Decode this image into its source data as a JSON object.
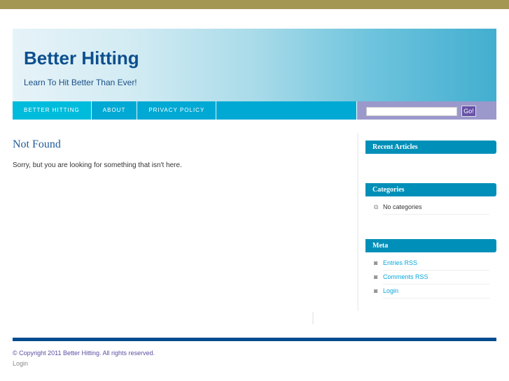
{
  "site": {
    "title": "Better Hitting",
    "tagline": "Learn To Hit Better Than Ever!"
  },
  "nav": {
    "items": [
      {
        "label": "BETTER HITTING"
      },
      {
        "label": "ABOUT"
      },
      {
        "label": "PRIVACY POLICY"
      }
    ]
  },
  "search": {
    "value": "",
    "button": "Go!"
  },
  "main": {
    "title": "Not Found",
    "message": "Sorry, but you are looking for something that isn't here."
  },
  "sidebar": {
    "recent": {
      "title": "Recent Articles"
    },
    "categories": {
      "title": "Categories",
      "items": [
        "No categories"
      ]
    },
    "meta": {
      "title": "Meta",
      "items": [
        "Entries RSS",
        "Comments RSS",
        "Login"
      ]
    }
  },
  "footer": {
    "copyright": "© Copyright 2011 Better Hitting. All rights reserved.",
    "login": "Login"
  }
}
